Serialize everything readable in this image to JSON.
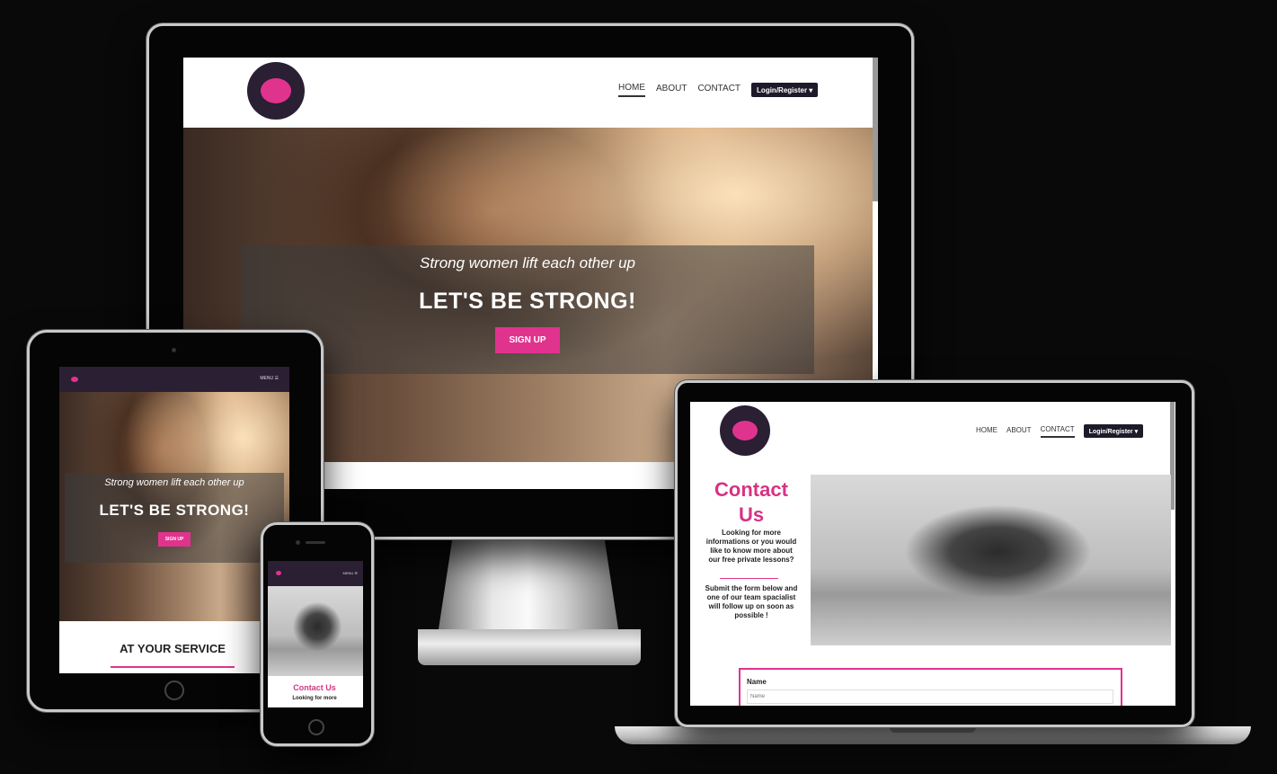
{
  "brand": {
    "accent": "#e0338e",
    "dark": "#2a1f33"
  },
  "desktop": {
    "nav": {
      "home": "HOME",
      "about": "ABOUT",
      "contact": "CONTACT",
      "login": "Login/Register"
    },
    "hero": {
      "tagline": "Strong women lift each other up",
      "title": "LET'S BE STRONG!",
      "cta": "SIGN UP"
    }
  },
  "tablet": {
    "menu": "MENU",
    "hero": {
      "tagline": "Strong women lift each other up",
      "title": "LET'S BE STRONG!",
      "cta": "SIGN UP"
    },
    "section_title": "AT YOUR SERVICE"
  },
  "phone": {
    "menu": "MENU",
    "contact_title": "Contact Us",
    "contact_text": "Looking for more"
  },
  "laptop": {
    "nav": {
      "home": "HOME",
      "about": "ABOUT",
      "contact": "CONTACT",
      "login": "Login/Register"
    },
    "contact": {
      "title": "Contact Us",
      "text1": "Looking for more informations or you would like to know more about our free private lessons?",
      "text2": "Submit the form below and one of our team spacialist will follow up on soon as possible !"
    },
    "form": {
      "name_label": "Name",
      "name_placeholder": "Name"
    }
  }
}
